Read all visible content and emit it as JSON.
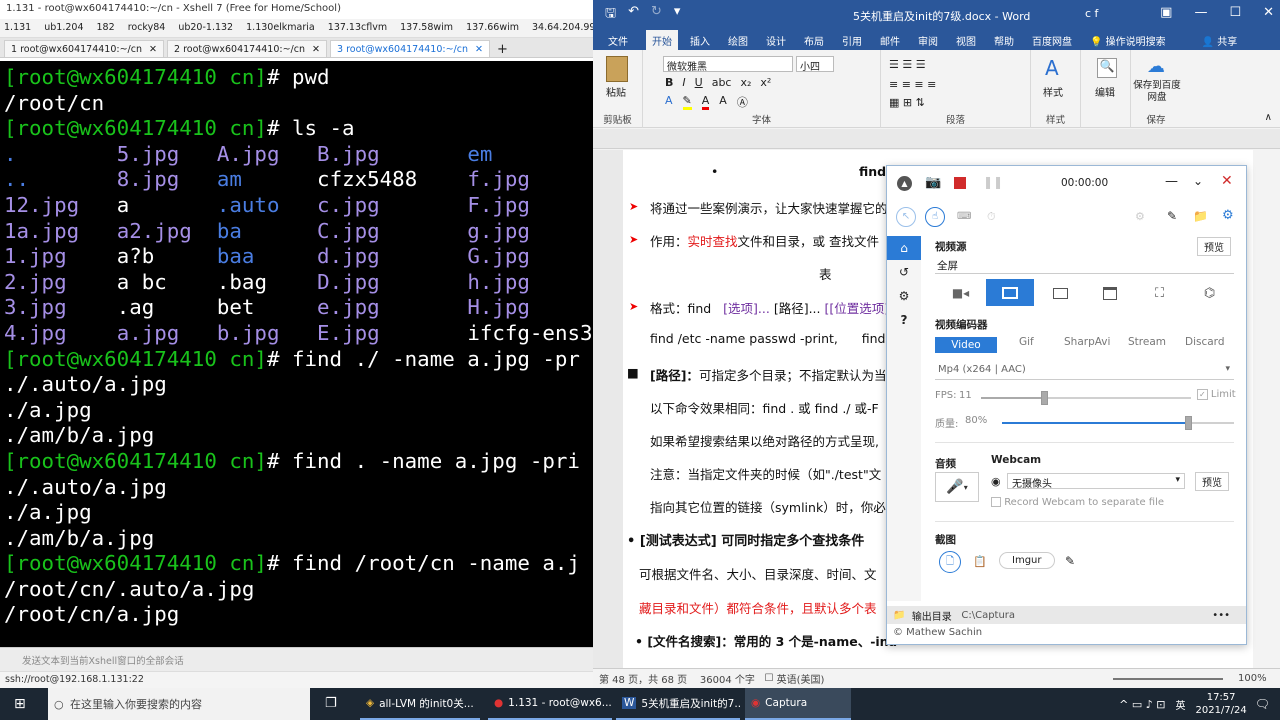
{
  "xshell": {
    "title": "1.131 - root@wx604174410:~/cn - Xshell 7 (Free for Home/School)",
    "bookmarks": [
      "1.131",
      "ub1.204",
      "182",
      "rocky84",
      "ub20-1.132",
      "1.130elkmaria",
      "137.13cflvm",
      "137.58wim",
      "137.66wim",
      "34.64.204.99"
    ],
    "tabs": [
      "1 root@wx604174410:~/cn",
      "2 root@wx604174410:~/cn",
      "3 root@wx604174410:~/cn"
    ],
    "terminal_lines": [
      "[root@wx604174410 cn]# pwd",
      "/root/cn",
      "[root@wx604174410 cn]# ls -a",
      ".        5.jpg   A.jpg   B.jpg       em",
      "..       8.jpg   am      cfzx5488    f.jpg",
      "12.jpg   a       .auto   c.jpg       F.jpg",
      "1a.jpg   a2.jpg  ba      C.jpg       g.jpg",
      "1.jpg    a?b     baa     d.jpg       G.jpg",
      "2.jpg    a bc    .bag    D.jpg       h.jpg",
      "3.jpg    .ag     bet     e.jpg       H.jpg",
      "4.jpg    a.jpg   b.jpg   E.jpg       ifcfg-ens33",
      "[root@wx604174410 cn]# find ./ -name a.jpg -pr",
      "./.auto/a.jpg",
      "./a.jpg",
      "./am/b/a.jpg",
      "[root@wx604174410 cn]# find . -name a.jpg -pri",
      "./.auto/a.jpg",
      "./a.jpg",
      "./am/b/a.jpg",
      "[root@wx604174410 cn]# find /root/cn -name a.j",
      "/root/cn/.auto/a.jpg",
      "/root/cn/a.jpg"
    ],
    "input_placeholder": "发送文本到当前Xshell窗口的全部会话",
    "status": "ssh://root@192.168.1.131:22"
  },
  "word": {
    "doc_title": "5关机重启及init的7级.docx - Word",
    "user": "c f",
    "tabs": [
      "文件",
      "开始",
      "插入",
      "绘图",
      "设计",
      "布局",
      "引用",
      "邮件",
      "审阅",
      "视图",
      "帮助",
      "百度网盘",
      "操作说明搜索",
      "共享"
    ],
    "active_tab": "开始",
    "ribbon": {
      "paste": "粘贴",
      "clipboard": "剪贴板",
      "font_name": "微软雅黑",
      "font_size": "小四",
      "font_group": "字体",
      "paragraph": "段落",
      "styles": "样式",
      "styles_group": "样式",
      "edit": "编辑",
      "save_baidu": "保存到百度网盘",
      "save_group": "保存"
    },
    "doc_lines": [
      "find",
      "将通过一些案例演示，让大家快速掌握它的",
      "作用：",
      "实时查找",
      "文件和目录，或 查找文件",
      "表",
      "格式：find",
      "[选项]...",
      "[路径]...",
      "[[位置选项]",
      "find /etc -name passwd -print,",
      "find",
      "[路径]：",
      "可指定多个目录；不指定默认为当",
      "以下命令效果相同：find . 或 find ./ 或-F",
      "如果希望搜索结果以绝对路径的方式呈现,",
      "注意：当指定文件夹的时候（如\"./test\"文",
      "指向其它位置的链接（symlink）时，你必",
      "[测试表达式]",
      "可同时指定多个查找条件",
      "可根据文件名、大小、目录深度、时间、文",
      "藏目录和文件）都符合条件，且默认多个表",
      "[文件名搜索]：常用的 3 个是-name、-ina"
    ],
    "status": {
      "page": "第 48 页，共 68 页",
      "words": "36004 个字",
      "lang": "英语(美国)",
      "zoom": "100%"
    }
  },
  "captura": {
    "time": "00:00:00",
    "video_source_label": "视频源",
    "preview": "预览",
    "source_value": "全屏",
    "encoder_label": "视频编码器",
    "encoders": [
      "Video",
      "Gif",
      "SharpAvi",
      "Stream",
      "Discard"
    ],
    "active_encoder": "Video",
    "codec": "Mp4 (x264 | AAC)",
    "fps_label": "FPS:",
    "fps_value": "11",
    "fps_fraction": 0.3,
    "limit": "Limit",
    "quality_label": "质量:",
    "quality_value": "80%",
    "quality_fraction": 0.8,
    "audio": "音频",
    "webcam_label": "Webcam",
    "webcam_value": "无摄像头",
    "webcam_preview": "预览",
    "webcam_separate": "Record Webcam to separate file",
    "screenshot": "截图",
    "imgur": "Imgur",
    "output_dir_label": "输出目录",
    "output_dir": "C:\\Captura",
    "credit": "© Mathew Sachin",
    "accent": "#2b7bd6"
  },
  "taskbar": {
    "search": "在这里输入你要搜索的内容",
    "apps": [
      "all-LVM 的init0关...",
      "1.131 - root@wx6...",
      "5关机重启及init的7...",
      "Captura"
    ],
    "ime": "英",
    "time": "17:57",
    "date": "2021/7/24"
  }
}
